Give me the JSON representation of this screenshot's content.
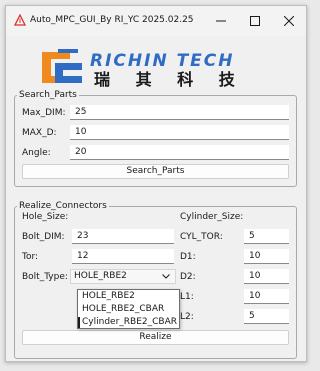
{
  "window": {
    "title": "Auto_MPC_GUI_By RI_YC 2025.02.25"
  },
  "logo": {
    "brand_en": "RICHIN TECH",
    "brand_cn": "瑞 其 科 技",
    "colors": {
      "blue": "#2f6cc4",
      "orange": "#f08a1e"
    }
  },
  "search_parts": {
    "legend": "Search_Parts",
    "fields": [
      {
        "label": "Max_DIM:",
        "value": "25"
      },
      {
        "label": "MAX_D:",
        "value": "10"
      },
      {
        "label": "Angle:",
        "value": "20"
      }
    ],
    "button": "Search_Parts"
  },
  "realize": {
    "legend": "Realize_Connectors",
    "hole_size_label": "Hole_Size:",
    "cylinder_size_label": "Cylinder_Size:",
    "bolt_dim": {
      "label": "Bolt_DIM:",
      "value": "23"
    },
    "tor": {
      "label": "Tor:",
      "value": "12"
    },
    "bolt_type": {
      "label": "Bolt_Type:",
      "value": "HOLE_RBE2"
    },
    "bolt_type_options": [
      "HOLE_RBE2",
      "HOLE_RBE2_CBAR",
      "Cylinder_RBE2_CBAR"
    ],
    "cyl_tor": {
      "label": "CYL_TOR:",
      "value": "5"
    },
    "d1": {
      "label": "D1:",
      "value": "10"
    },
    "d2": {
      "label": "D2:",
      "value": "10"
    },
    "l1": {
      "label": "L1:",
      "value": "10"
    },
    "l2": {
      "label": "L2:",
      "value": "5"
    },
    "button": "Realize"
  }
}
